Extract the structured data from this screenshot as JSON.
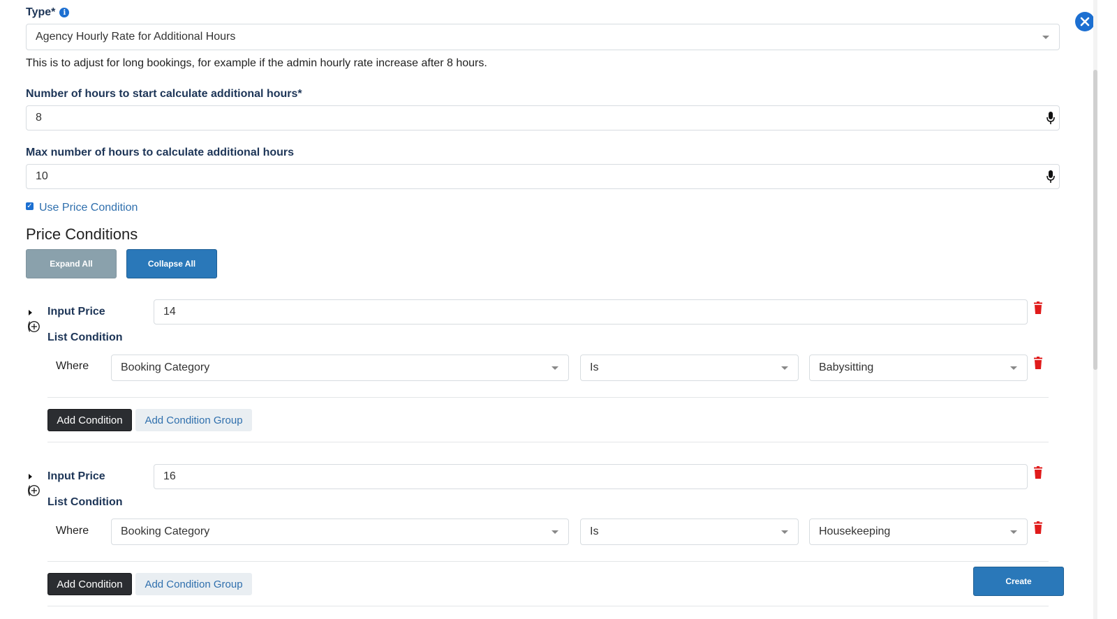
{
  "type_field": {
    "label": "Type*",
    "value": "Agency Hourly Rate for Additional Hours",
    "help": "This is to adjust for long bookings, for example if the admin hourly rate increase after 8 hours."
  },
  "start_hours": {
    "label": "Number of hours to start calculate additional hours*",
    "value": "8"
  },
  "max_hours": {
    "label": "Max number of hours to calculate additional hours",
    "value": "10"
  },
  "use_price_condition": {
    "label": "Use Price Condition",
    "checked": true
  },
  "price_conditions": {
    "title": "Price Conditions",
    "expand_all": "Expand All",
    "collapse_all": "Collapse All",
    "items": [
      {
        "input_price_label": "Input Price",
        "input_price_value": "14",
        "list_condition_label": "List Condition",
        "where_label": "Where",
        "field": "Booking Category",
        "operator": "Is",
        "value": "Babysitting",
        "add_condition": "Add Condition",
        "add_condition_group": "Add Condition Group"
      },
      {
        "input_price_label": "Input Price",
        "input_price_value": "16",
        "list_condition_label": "List Condition",
        "where_label": "Where",
        "field": "Booking Category",
        "operator": "Is",
        "value": "Housekeeping",
        "add_condition": "Add Condition",
        "add_condition_group": "Add Condition Group"
      }
    ]
  },
  "create_button": "Create",
  "colors": {
    "primary": "#2a78b9",
    "muted_button": "#8aa1ac",
    "danger": "#e01b1b",
    "label": "#1d3557",
    "link": "#2f6fad"
  }
}
